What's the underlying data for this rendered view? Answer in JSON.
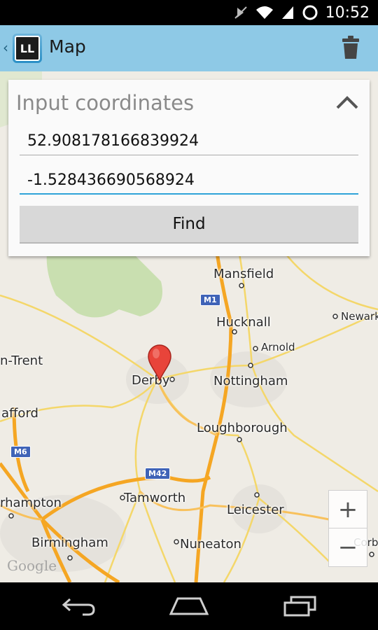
{
  "status_bar": {
    "time": "10:52"
  },
  "action_bar": {
    "title": "Map",
    "logo_text": "LL"
  },
  "panel": {
    "title": "Input coordinates",
    "latitude": "52.908178166839924",
    "longitude": "-1.528436690568924",
    "find_label": "Find"
  },
  "map": {
    "places": {
      "mansfield": "Mansfield",
      "hucknall": "Hucknall",
      "newark": "Newark",
      "arnold": "Arnold",
      "trent": "n-Trent",
      "derby": "Derby",
      "nottingham": "Nottingham",
      "stafford": "afford",
      "loughborough": "Loughborough",
      "wolverhampton": "rhampton",
      "tamworth": "Tamworth",
      "leicester": "Leicester",
      "birmingham": "Birmingham",
      "nuneaton": "Nuneaton",
      "corby": "Corb"
    },
    "road_shields": {
      "m1": "M1",
      "m6": "M6",
      "m42": "M42"
    },
    "attribution": "Google"
  },
  "zoom": {
    "in": "+",
    "out": "−"
  },
  "icons": {
    "back": "chevron-left-icon",
    "trash": "trash-icon",
    "collapse": "chevron-up-icon",
    "marker": "map-pin-icon"
  }
}
